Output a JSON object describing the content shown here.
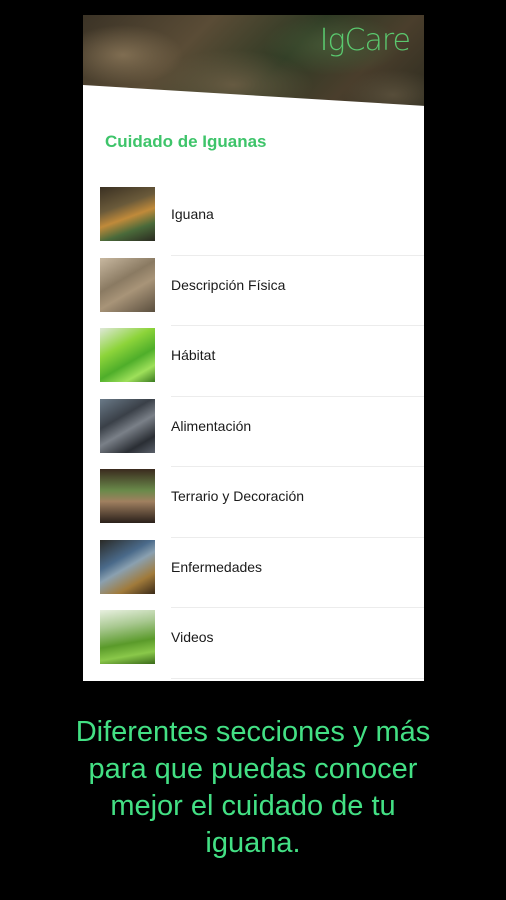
{
  "app": {
    "logo_text": "IgCare",
    "title": "Cuidado de Iguanas",
    "accent_color": "#3ec46a"
  },
  "menu": {
    "items": [
      {
        "label": "Iguana"
      },
      {
        "label": "Descripción Física"
      },
      {
        "label": "Hábitat"
      },
      {
        "label": "Alimentación"
      },
      {
        "label": "Terrario y Decoración"
      },
      {
        "label": "Enfermedades"
      },
      {
        "label": "Videos"
      }
    ]
  },
  "caption": {
    "line1": "Diferentes secciones y más",
    "line2": "para que puedas conocer",
    "line3": "mejor el cuidado de tu",
    "line4": "iguana.",
    "color": "#43e084"
  }
}
